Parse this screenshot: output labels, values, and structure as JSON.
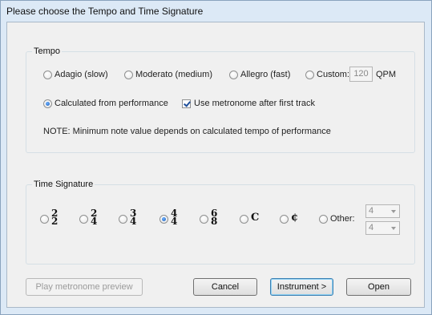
{
  "dialog": {
    "title": "Please choose the Tempo and Time Signature"
  },
  "tempo": {
    "group_label": "Tempo",
    "options": [
      {
        "label": "Adagio (slow)",
        "checked": false
      },
      {
        "label": "Moderato (medium)",
        "checked": false
      },
      {
        "label": "Allegro (fast)",
        "checked": false
      },
      {
        "label": "Custom:",
        "checked": false
      }
    ],
    "custom_value": "120",
    "custom_unit": "QPM",
    "calculated_label": "Calculated from performance",
    "calculated_checked": true,
    "metronome_label": "Use metronome after first track",
    "metronome_checked": true,
    "note": "NOTE: Minimum note value depends on calculated tempo of performance"
  },
  "time_signature": {
    "group_label": "Time Signature",
    "options": [
      {
        "top": "2",
        "bottom": "2",
        "checked": false
      },
      {
        "top": "2",
        "bottom": "4",
        "checked": false
      },
      {
        "top": "3",
        "bottom": "4",
        "checked": false
      },
      {
        "top": "4",
        "bottom": "4",
        "checked": true
      },
      {
        "top": "6",
        "bottom": "8",
        "checked": false
      },
      {
        "symbol": "C",
        "checked": false
      },
      {
        "symbol": "¢",
        "checked": false
      }
    ],
    "other_label": "Other:",
    "other_top": "4",
    "other_bottom": "4"
  },
  "buttons": {
    "preview": "Play metronome preview",
    "cancel": "Cancel",
    "instrument": "Instrument >",
    "open": "Open"
  }
}
